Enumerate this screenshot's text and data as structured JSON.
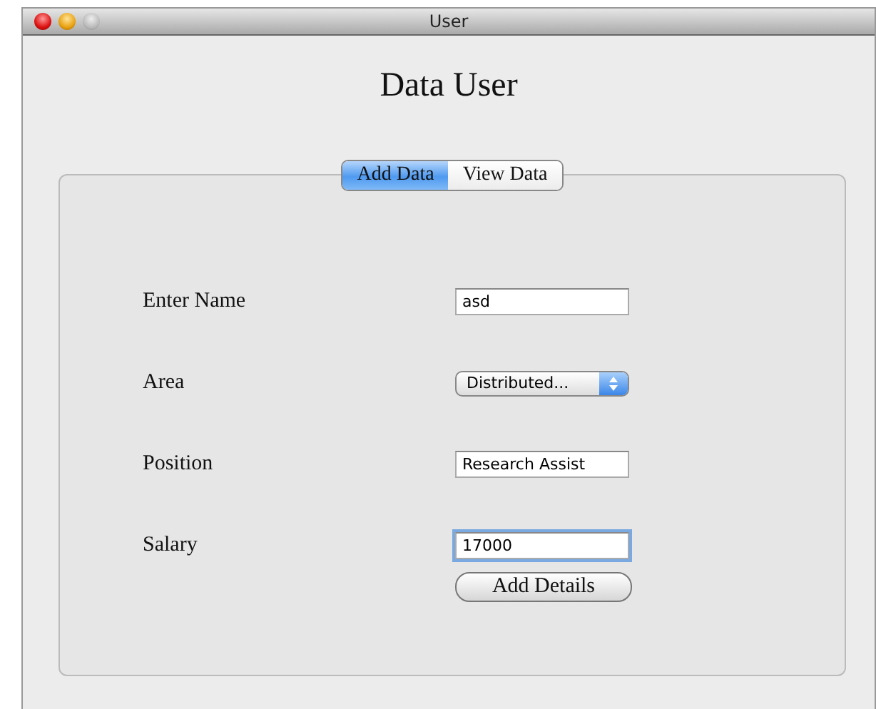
{
  "window": {
    "title": "User"
  },
  "heading": "Data User",
  "tabs": [
    {
      "label": "Add Data",
      "selected": true
    },
    {
      "label": "View Data",
      "selected": false
    }
  ],
  "form": [
    {
      "kind": "text",
      "label": "Enter Name",
      "value": "asd",
      "focused": false
    },
    {
      "kind": "popup",
      "label": "Area",
      "value": "Distributed...",
      "focused": false
    },
    {
      "kind": "text",
      "label": "Position",
      "value": "Research Assist",
      "focused": false
    },
    {
      "kind": "text",
      "label": "Salary",
      "value": "17000",
      "focused": true
    }
  ],
  "button": "Add Details"
}
